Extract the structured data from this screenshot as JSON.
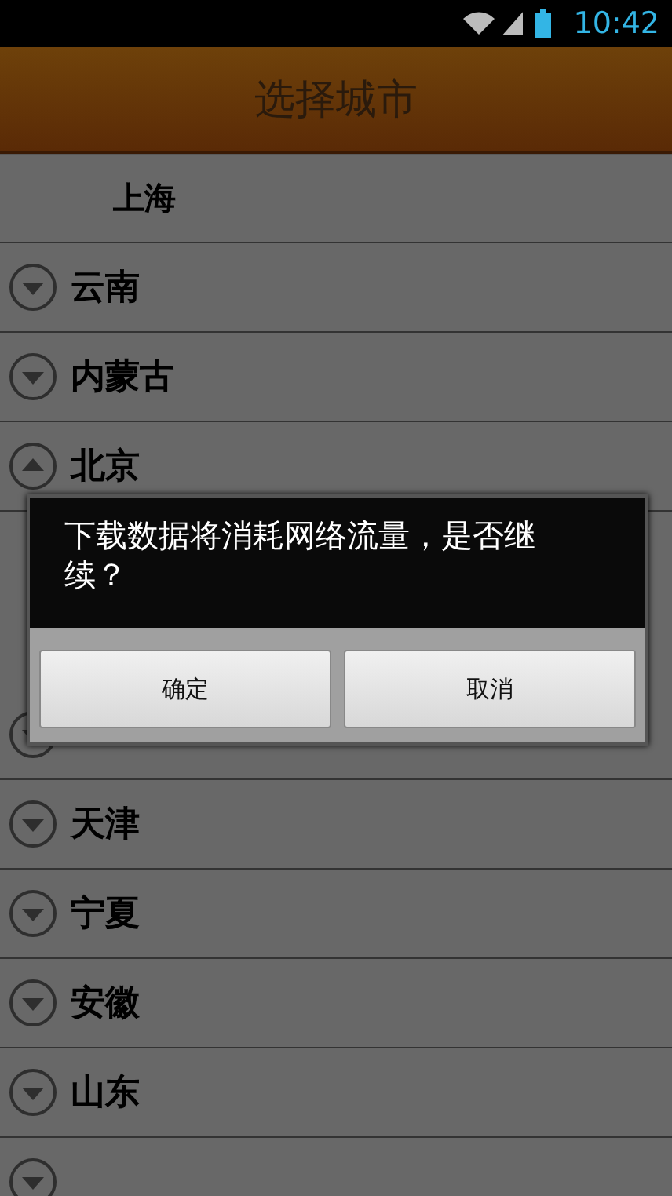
{
  "status_bar": {
    "time": "10:42"
  },
  "header": {
    "title": "选择城市"
  },
  "list": [
    {
      "kind": "child",
      "name": "上海"
    },
    {
      "kind": "group",
      "name": "云南",
      "expanded": false
    },
    {
      "kind": "group",
      "name": "内蒙古",
      "expanded": false
    },
    {
      "kind": "group",
      "name": "北京",
      "expanded": true
    },
    {
      "kind": "group",
      "expanded": false
    },
    {
      "kind": "group",
      "name": "天津",
      "expanded": false
    },
    {
      "kind": "group",
      "name": "宁夏",
      "expanded": false
    },
    {
      "kind": "group",
      "name": "安徽",
      "expanded": false
    },
    {
      "kind": "group",
      "name": "山东",
      "expanded": false
    },
    {
      "kind": "group",
      "expanded": false
    }
  ],
  "dialog": {
    "message": "下载数据将消耗网络流量，是否继续？",
    "buttons": [
      "确定",
      "取消"
    ]
  }
}
